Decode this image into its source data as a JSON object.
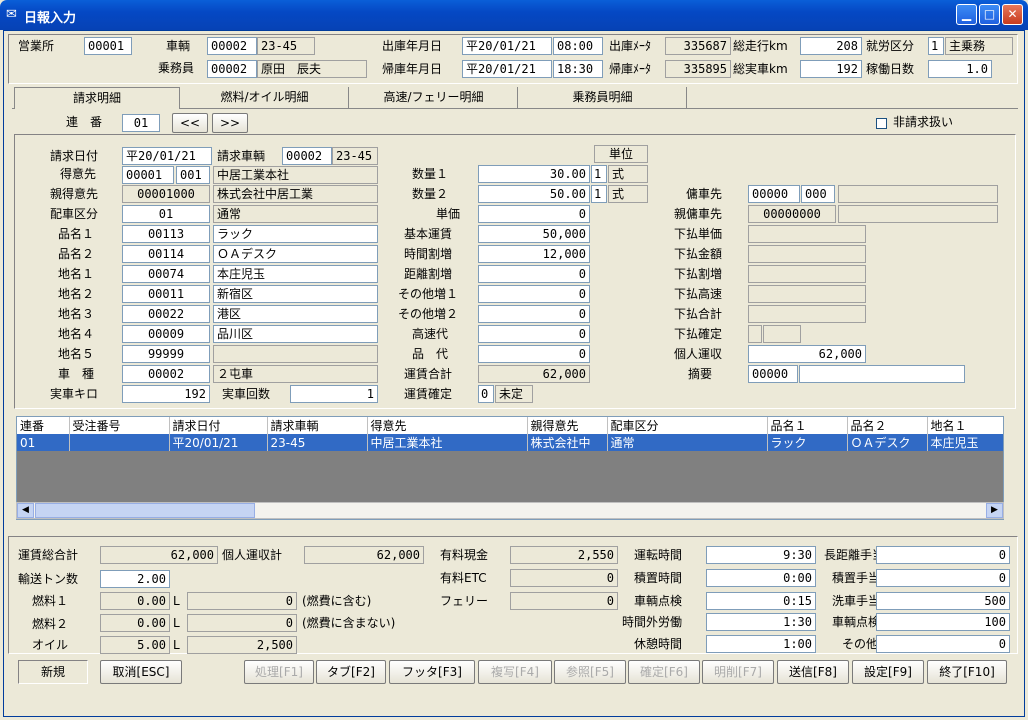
{
  "window": {
    "title": "日報入力"
  },
  "header": {
    "eigyosho_label": "営業所",
    "eigyosho": "00001",
    "sharyo_label": "車輌",
    "sharyo_code": "00002",
    "sharyo_no": "23-45",
    "jomuin_label": "乗務員",
    "jomuin_code": "00002",
    "jomuin_name": "原田　辰夫",
    "shuko_label": "出庫年月日",
    "shuko_date": "平20/01/21",
    "shuko_time": "08:00",
    "shuko_meter_label": "出庫ﾒｰﾀ",
    "shuko_meter": "335687",
    "kiko_label": "帰庫年月日",
    "kiko_date": "平20/01/21",
    "kiko_time": "18:30",
    "kiko_meter_label": "帰庫ﾒｰﾀ",
    "kiko_meter": "335895",
    "sokoko_label": "総走行km",
    "sokoko": "208",
    "sojissha_label": "総実車km",
    "sojissha": "192",
    "shuro_label": "就労区分",
    "shuro_code": "1",
    "shuro_name": "主乗務",
    "kado_label": "稼働日数",
    "kado": "1.0"
  },
  "tabs": [
    "請求明細",
    "燃料/オイル明細",
    "高速/フェリー明細",
    "乗務員明細"
  ],
  "renban": {
    "label": "連　番",
    "value": "01",
    "prev": "<<",
    "next": ">>"
  },
  "hiseikyu_label": "非請求扱い",
  "left": {
    "seikyu_date_label": "請求日付",
    "seikyu_date": "平20/01/21",
    "seikyu_sharyo_label": "請求車輌",
    "seikyu_sharyo_code": "00002",
    "seikyu_sharyo_no": "23-45",
    "tokui_label": "得意先",
    "tokui_code": "00001",
    "tokui_sub": "001",
    "tokui_name": "中居工業本社",
    "oya_label": "親得意先",
    "oya_code": "00001000",
    "oya_name": "株式会社中居工業",
    "haisha_label": "配車区分",
    "haisha_code": "01",
    "haisha_name": "通常",
    "hinmei1_label": "品名１",
    "hinmei1_code": "00113",
    "hinmei1": "ラック",
    "hinmei2_label": "品名２",
    "hinmei2_code": "00114",
    "hinmei2": "ＯＡデスク",
    "chimei1_label": "地名１",
    "chimei1_code": "00074",
    "chimei1": "本庄児玉",
    "chimei2_label": "地名２",
    "chimei2_code": "00011",
    "chimei2": "新宿区",
    "chimei3_label": "地名３",
    "chimei3_code": "00022",
    "chimei3": "港区",
    "chimei4_label": "地名４",
    "chimei4_code": "00009",
    "chimei4": "品川区",
    "chimei5_label": "地名５",
    "chimei5_code": "99999",
    "chimei5": "",
    "shashu_label": "車　種",
    "shashu_code": "00002",
    "shashu": "２屯車",
    "jissha_km_label": "実車キロ",
    "jissha_km": "192",
    "jissha_kaisu_label": "実車回数",
    "jissha_kaisu": "1"
  },
  "middle": {
    "tani_label": "単位",
    "suryo1_label": "数量１",
    "suryo1": "30.00",
    "suryo1_unit_code": "1",
    "suryo1_unit": "式",
    "suryo2_label": "数量２",
    "suryo2": "50.00",
    "suryo2_unit_code": "1",
    "suryo2_unit": "式",
    "tanka_label": "単価",
    "tanka": "0",
    "kihon_label": "基本運賃",
    "kihon": "50,000",
    "jikan_label": "時間割増",
    "jikan": "12,000",
    "kyori_label": "距離割増",
    "kyori": "0",
    "sonota1_label": "その他増１",
    "sonota1": "0",
    "sonota2_label": "その他増２",
    "sonota2": "0",
    "kosoku_label": "高速代",
    "kosoku": "0",
    "hinmei_dai_label": "品　代",
    "hinmei_dai": "0",
    "unchin_label": "運賃合計",
    "unchin": "62,000",
    "kakutei_label": "運賃確定",
    "kakutei_code": "0",
    "kakutei": "未定"
  },
  "right": {
    "yosha_label": "傭車先",
    "yosha_code": "00000",
    "yosha_sub": "000",
    "oya_yosha_label": "親傭車先",
    "oya_yosha_code": "00000000",
    "shitabarai_tanka_label": "下払単価",
    "shitabarai_kingaku_label": "下払金額",
    "shitabarai_warimashi_label": "下払割増",
    "shitabarai_kosoku_label": "下払高速",
    "shitabarai_gokei_label": "下払合計",
    "shitabarai_kakutei_label": "下払確定",
    "kojin_label": "個人運収",
    "kojin": "62,000",
    "tekiyo_label": "摘要",
    "tekiyo_code": "00000"
  },
  "table": {
    "headers": [
      "連番",
      "受注番号",
      "請求日付",
      "請求車輌",
      "得意先",
      "親得意先",
      "配車区分",
      "品名１",
      "品名２",
      "地名１"
    ],
    "rows": [
      [
        "01",
        "",
        "平20/01/21",
        "23-45",
        "中居工業本社",
        "株式会社中",
        "通常",
        "ラック",
        "ＯＡデスク",
        "本庄児玉"
      ]
    ]
  },
  "footer": {
    "unchin_sogokei_label": "運賃総合計",
    "unchin_sogokei": "62,000",
    "kojin_unshu_label": "個人運収計",
    "kojin_unshu": "62,000",
    "yuryo_genkin_label": "有料現金",
    "yuryo_genkin": "2,550",
    "yuryo_etc_label": "有料ETC",
    "yuryo_etc": "0",
    "ferry_label": "フェリー",
    "ferry": "0",
    "yuso_ton_label": "輸送トン数",
    "yuso_ton": "2.00",
    "nenryo1_label": "燃料１",
    "nenryo1": "0.00",
    "nenryo1_unit": "L",
    "nenryo1_yen": "0",
    "nenryo1_note": "(燃費に含む)",
    "nenryo2_label": "燃料２",
    "nenryo2": "0.00",
    "nenryo2_unit": "L",
    "nenryo2_yen": "0",
    "nenryo2_note": "(燃費に含まない)",
    "oil_label": "オイル",
    "oil": "5.00",
    "oil_unit": "L",
    "oil_yen": "2,500",
    "unten_label": "運転時間",
    "unten": "9:30",
    "sekichi_label": "積置時間",
    "sekichi": "0:00",
    "tenken_label": "車輌点検",
    "tenken": "0:15",
    "jikangai_label": "時間外労働",
    "jikangai": "1:30",
    "kyukei_label": "休憩時間",
    "kyukei": "1:00",
    "chokyori_label": "長距離手当",
    "chokyori": "0",
    "sekichi_teate_label": "積置手当",
    "sekichi_teate": "0",
    "sensha_label": "洗車手当",
    "sensha": "500",
    "sharyo_tenken_label": "車輌点検",
    "sharyo_tenken": "100",
    "sonota_label": "その他",
    "sonota": "0"
  },
  "buttons": {
    "mode": "新規",
    "cancel": "取消[ESC]",
    "process": "処理[F1]",
    "tab": "タブ[F2]",
    "footer": "フッタ[F3]",
    "copy": "複写[F4]",
    "ref": "参照[F5]",
    "confirm": "確定[F6]",
    "delete_line": "明削[F7]",
    "send": "送信[F8]",
    "settings": "設定[F9]",
    "exit": "終了[F10]"
  }
}
